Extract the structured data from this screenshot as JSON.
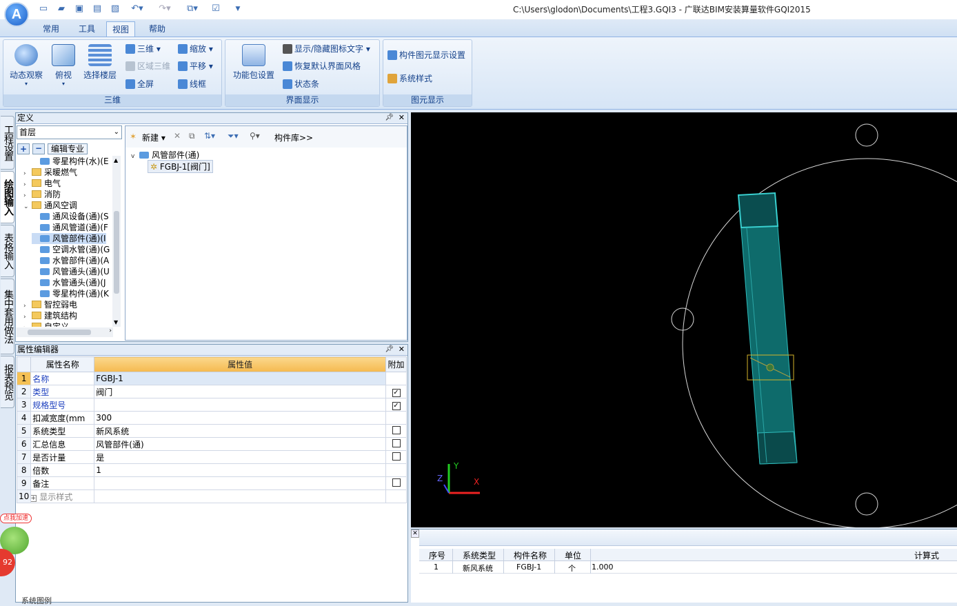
{
  "app": {
    "logo_letter": "A",
    "window_title": "C:\\Users\\glodon\\Documents\\工程3.GQI3 - 广联达BIM安装算量软件GQI2015"
  },
  "ribbon": {
    "tabs": [
      "常用",
      "工具",
      "视图",
      "帮助"
    ],
    "active_tab": "视图",
    "groups": {
      "three_d": {
        "label": "三维",
        "big": [
          "动态观察",
          "俯视",
          "选择楼层"
        ],
        "small": [
          "三维",
          "区域三维",
          "全屏",
          "缩放",
          "平移",
          "线框"
        ]
      },
      "ui_display": {
        "label": "界面显示",
        "big": [
          "功能包设置"
        ],
        "small": [
          "显示/隐藏图标文字",
          "恢复默认界面风格",
          "状态条"
        ]
      },
      "element_display": {
        "label": "图元显示",
        "small": [
          "构件图元显示设置",
          "系统样式"
        ]
      }
    }
  },
  "vtabs": [
    "工程设置",
    "绘图输入",
    "表格输入",
    "集中套用做法",
    "报表预览"
  ],
  "definition": {
    "title": "定义",
    "floor": "首层",
    "edit_specialty": "编辑专业",
    "tree": [
      {
        "label": "零星构件(水)(E",
        "type": "comp",
        "indent": 2
      },
      {
        "label": "采暖燃气",
        "type": "folder",
        "indent": 1,
        "arrow": ">"
      },
      {
        "label": "电气",
        "type": "folder",
        "indent": 1,
        "arrow": ">"
      },
      {
        "label": "消防",
        "type": "folder",
        "indent": 1,
        "arrow": ">"
      },
      {
        "label": "通风空调",
        "type": "folder",
        "indent": 1,
        "arrow": "v"
      },
      {
        "label": "通风设备(通)(S",
        "type": "comp",
        "indent": 2
      },
      {
        "label": "通风管道(通)(F",
        "type": "comp",
        "indent": 2
      },
      {
        "label": "风管部件(通)(I",
        "type": "comp",
        "indent": 2,
        "selected": true
      },
      {
        "label": "空调水管(通)(G",
        "type": "comp",
        "indent": 2
      },
      {
        "label": "水管部件(通)(A",
        "type": "comp",
        "indent": 2
      },
      {
        "label": "风管通头(通)(U",
        "type": "comp",
        "indent": 2
      },
      {
        "label": "水管通头(通)(J",
        "type": "comp",
        "indent": 2
      },
      {
        "label": "零星构件(通)(K",
        "type": "comp",
        "indent": 2
      },
      {
        "label": "智控弱电",
        "type": "folder",
        "indent": 1,
        "arrow": ">"
      },
      {
        "label": "建筑结构",
        "type": "folder",
        "indent": 1,
        "arrow": ">"
      },
      {
        "label": "自定义",
        "type": "folder",
        "indent": 1,
        "arrow": ">"
      }
    ],
    "toolbar": {
      "new": "新建",
      "library": "构件库>>"
    },
    "list_root": "风管部件(通)",
    "list_child": "FGBJ-1[阀门]"
  },
  "properties": {
    "title": "属性编辑器",
    "headers": [
      "属性名称",
      "属性值",
      "附加"
    ],
    "rows": [
      {
        "n": "1",
        "name": "名称",
        "value": "FGBJ-1",
        "check": "none",
        "blue": true
      },
      {
        "n": "2",
        "name": "类型",
        "value": "阀门",
        "check": "checked",
        "blue": true
      },
      {
        "n": "3",
        "name": "规格型号",
        "value": "",
        "check": "checked",
        "blue": true
      },
      {
        "n": "4",
        "name": "扣减宽度(mm",
        "value": "300",
        "check": "none",
        "blue": false
      },
      {
        "n": "5",
        "name": "系统类型",
        "value": "新风系统",
        "check": "empty",
        "blue": false
      },
      {
        "n": "6",
        "name": "汇总信息",
        "value": "风管部件(通)",
        "check": "empty",
        "blue": false
      },
      {
        "n": "7",
        "name": "是否计量",
        "value": "是",
        "check": "empty",
        "blue": false
      },
      {
        "n": "8",
        "name": "倍数",
        "value": "1",
        "check": "none",
        "blue": false
      },
      {
        "n": "9",
        "name": "备注",
        "value": "",
        "check": "empty",
        "blue": false
      },
      {
        "n": "10",
        "name": "显示样式",
        "value": "",
        "check": "none",
        "blue": false,
        "expand": true
      }
    ],
    "badge_text": "点我加速",
    "badge_number": "92",
    "footer_text": "系统图例"
  },
  "viewport": {
    "axis_x": "X",
    "axis_y": "Y",
    "axis_z": "Z"
  },
  "bottom_table": {
    "headers": [
      "序号",
      "系统类型",
      "构件名称",
      "单位",
      "",
      "计算式"
    ],
    "row": [
      "1",
      "新风系统",
      "FGBJ-1",
      "个",
      "1.000",
      ""
    ]
  },
  "colors": {
    "accent": "#15428b",
    "teal": "#0e6b6b",
    "header_orange": "#f5b94f"
  }
}
